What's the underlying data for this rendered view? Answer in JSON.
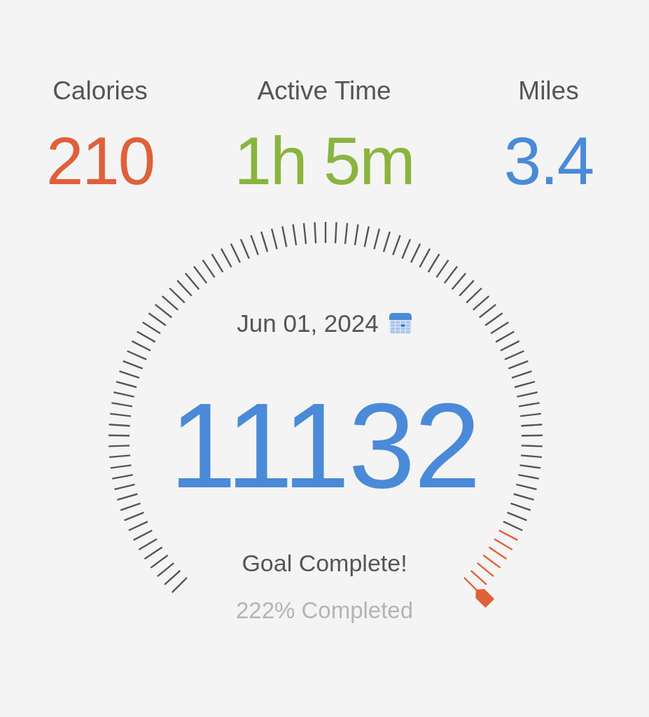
{
  "stats": [
    {
      "label": "Calories",
      "value": "210",
      "color": "#e0603a"
    },
    {
      "label": "Active Time",
      "value": "1h 5m",
      "color": "#8ab43f"
    },
    {
      "label": "Miles",
      "value": "3.4",
      "color": "#4a8ad8"
    }
  ],
  "gauge": {
    "date": "Jun 01, 2024",
    "steps": "11132",
    "status": "Goal Complete!",
    "completion": "222% Completed"
  }
}
